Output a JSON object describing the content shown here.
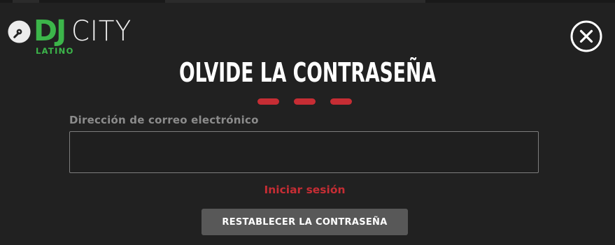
{
  "colors": {
    "background": "#212121",
    "brand_green": "#3cb54a",
    "accent_red": "#c62d34",
    "label_gray": "#8c8c8c",
    "button_gray": "#585858"
  },
  "logo": {
    "dj": "DJ",
    "city": "CITY",
    "sub": "LATINO",
    "disc_icon": "vinyl-record-icon"
  },
  "close_icon": "close-circle-icon",
  "modal": {
    "title": "OLVIDE LA CONTRASEÑA",
    "email_label": "Dirección de correo electrónico",
    "email_value": "",
    "email_placeholder": "",
    "signin_link": "Iniciar sesión",
    "reset_button": "RESTABLECER LA CONTRASEÑA"
  }
}
